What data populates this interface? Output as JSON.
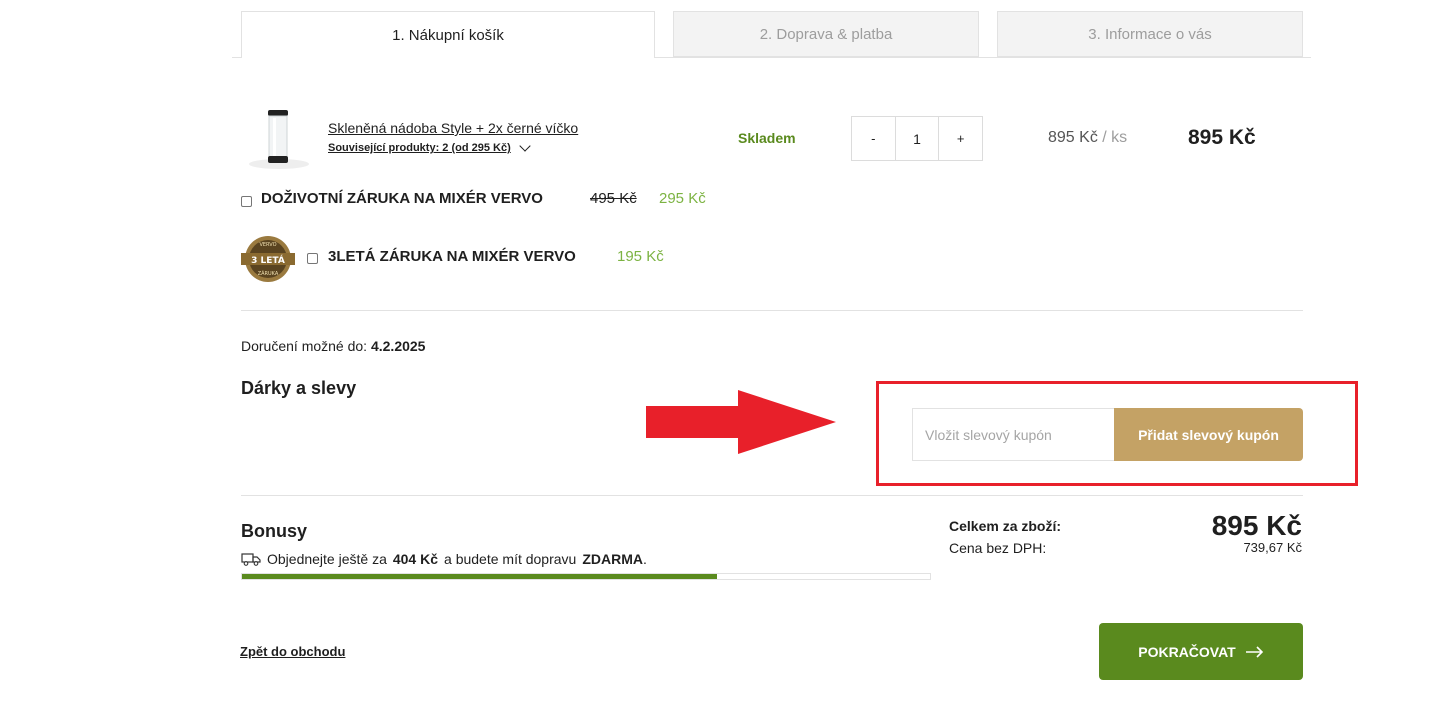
{
  "tabs": [
    {
      "label": "1. Nákupní košík"
    },
    {
      "label": "2. Doprava & platba"
    },
    {
      "label": "3. Informace o vás"
    }
  ],
  "product": {
    "title": "Skleněná nádoba Style + 2x černé víčko",
    "related": "Související produkty: 2 (od 295 Kč)",
    "stock": "Skladem",
    "qty_minus": "-",
    "qty_value": "1",
    "qty_plus": "+",
    "unit_price": "895 Kč",
    "unit_suffix": " / ks",
    "total": "895 Kč"
  },
  "warranties": [
    {
      "label": "DOŽIVOTNÍ ZÁRUKA NA MIXÉR VERVO",
      "old_price": "495 Kč",
      "price": "295 Kč"
    },
    {
      "label": "3LETÁ ZÁRUKA NA MIXÉR VERVO",
      "price": "195 Kč"
    }
  ],
  "badge": {
    "top": "VERVO",
    "middle": "3 LETÁ",
    "bottom": "ZÁRUKA"
  },
  "delivery": {
    "label": "Doručení možné do:",
    "date": "4.2.2025"
  },
  "gifts": {
    "title": "Dárky a slevy",
    "coupon_placeholder": "Vložit slevový kupón",
    "coupon_button": "Přidat slevový kupón"
  },
  "bonus": {
    "title": "Bonusy",
    "text_pre": "Objednejte ještě za",
    "amount": "404 Kč",
    "text_mid": "a budete mít dopravu",
    "free": "ZDARMA",
    "text_end": ".",
    "progress": 0.69
  },
  "summary": {
    "total_label": "Celkem za zboží:",
    "total": "895 Kč",
    "novat_label": "Cena bez DPH:",
    "novat": "739,67 Kč"
  },
  "back_link": "Zpět do obchodu",
  "continue_button": "POKRAČOVAT",
  "colors": {
    "accent_green": "#5a8a1e",
    "gold": "#c4a265",
    "highlight_red": "#e8202a"
  }
}
